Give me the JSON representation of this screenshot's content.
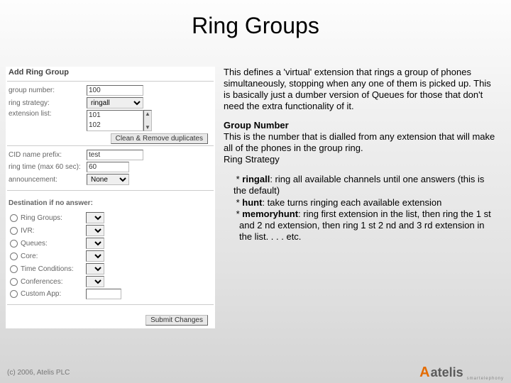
{
  "title": "Ring Groups",
  "form": {
    "heading": "Add Ring Group",
    "labels": {
      "group_number": "group number:",
      "ring_strategy": "ring strategy:",
      "extension_list": "extension list:",
      "cid_prefix": "CID name prefix:",
      "ring_time": "ring time (max 60 sec):",
      "announcement": "announcement:",
      "destination": "Destination if no answer:"
    },
    "values": {
      "group_number": "100",
      "ring_strategy": "ringall",
      "ext1": "101",
      "ext2": "102",
      "cid_prefix": "test",
      "ring_time": "60",
      "announcement": "None"
    },
    "buttons": {
      "clean": "Clean & Remove duplicates",
      "submit": "Submit Changes"
    },
    "dest_options": [
      "Ring Groups:",
      "IVR:",
      "Queues:",
      "Core:",
      "Time Conditions:",
      "Conferences:",
      "Custom App:"
    ]
  },
  "desc": {
    "intro": "This defines a 'virtual' extension that rings a group of phones simultaneously, stopping when any one of them is picked up. This is basically just a dumber version of Queues for those that don't need the extra functionality of it.",
    "section_head": "Group Number",
    "section_body1": "This is the number that is dialled from any extension that will make all of the phones in the group ring.",
    "section_body2": "Ring Strategy",
    "bullets": {
      "ringall_k": "ringall",
      "ringall_v": ": ring all available channels until one answers (this is the default)",
      "hunt_k": "hunt",
      "hunt_v": ": take turns ringing each available extension",
      "memoryhunt_k": "memoryhunt",
      "memoryhunt_v": ": ring first extension in the list, then ring the 1 st and 2 nd extension, then ring 1 st 2 nd and 3 rd extension in the list. . . . etc."
    }
  },
  "footer": {
    "copyright": "(c) 2006, Atelis PLC",
    "brand": "atelis",
    "tagline": "smartelephony"
  }
}
